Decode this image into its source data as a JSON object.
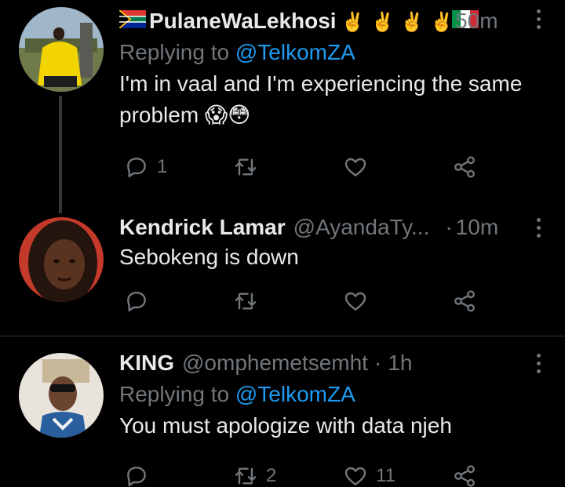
{
  "tweets": [
    {
      "display_name": "PulaneWaLekhosi",
      "name_emoji": "✌️✌️✌️✌️",
      "time": "50m",
      "replying_prefix": "Replying to",
      "replying_to": "@TelkomZA",
      "text": "I'm in vaal and I'm experiencing the same problem",
      "text_emoji": "😱😳",
      "reply_count": "1",
      "retweet_count": "",
      "like_count": ""
    },
    {
      "display_name": "Kendrick Lamar",
      "handle": "@AyandaTy...",
      "dot": "·",
      "time": "10m",
      "text": "Sebokeng is down",
      "reply_count": "",
      "retweet_count": "",
      "like_count": ""
    },
    {
      "display_name": "KING",
      "handle": "@omphemetsemht",
      "dot": "·",
      "time": "1h",
      "replying_prefix": "Replying to",
      "replying_to": "@TelkomZA",
      "text": "You must apologize with data njeh",
      "reply_count": "",
      "retweet_count": "2",
      "like_count": "11"
    }
  ],
  "icons": {
    "reply": "reply-icon",
    "retweet": "retweet-icon",
    "like": "heart-icon",
    "share": "share-icon",
    "more": "more-dots-icon",
    "flag_za": "south-africa-flag-icon",
    "flag_it": "italy-flag-icon"
  },
  "colors": {
    "background": "#000000",
    "text": "#e7e9ea",
    "secondary": "#71767b",
    "link": "#1d9bf0",
    "divider": "#2f3336"
  }
}
